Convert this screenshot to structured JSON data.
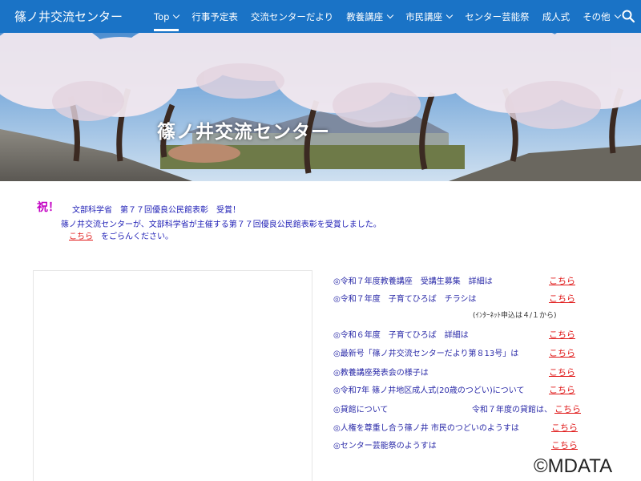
{
  "site": {
    "title": "篠ノ井交流センター"
  },
  "nav": {
    "items": [
      {
        "label": "Top",
        "active": true,
        "dropdown": true
      },
      {
        "label": "行事予定表",
        "active": false,
        "dropdown": false
      },
      {
        "label": "交流センターだより",
        "active": false,
        "dropdown": false
      },
      {
        "label": "教養講座",
        "active": false,
        "dropdown": true
      },
      {
        "label": "市民講座",
        "active": false,
        "dropdown": true
      },
      {
        "label": "センター芸能祭",
        "active": false,
        "dropdown": false
      },
      {
        "label": "成人式",
        "active": false,
        "dropdown": false
      },
      {
        "label": "その他",
        "active": false,
        "dropdown": true
      }
    ],
    "search_icon": "search-icon"
  },
  "hero": {
    "title": "篠ノ井交流センター"
  },
  "notice": {
    "mark": "祝！",
    "headline": "文部科学省　第７７回優良公民館表彰　受賞！",
    "body": "篠ノ井交流センターが、文部科学省が主催する第７７回優良公民館表彰を受賞しました。",
    "link": "こちら",
    "tail": "をごらんください。"
  },
  "links": [
    {
      "text": "◎令和７年度教養講座　受講生募集　詳細は",
      "link": "こちら"
    },
    {
      "text": "◎令和７年度　子育てひろば　チラシは",
      "link": "こちら"
    },
    {
      "text": "◎令和６年度　子育てひろば　詳細は",
      "link": "こちら"
    },
    {
      "text": "◎最新号「篠ノ井交流センターだより第８13号」は",
      "link": "こちら"
    },
    {
      "text": "◎教養講座発表会の様子は",
      "link": "こちら"
    },
    {
      "text": "◎令和7年 篠ノ井地区成人式(20歳のつどい)について",
      "link": "こちら"
    },
    {
      "text": "◎貸館について",
      "extra": "令和７年度の貸館は、",
      "link": "こちら"
    },
    {
      "text": "◎人権を尊重し合う篠ノ井 市民のつどいのようすは",
      "link": "こちら"
    },
    {
      "text": "◎センター芸能祭のようすは",
      "link": "こちら"
    }
  ],
  "note": "(ｲﾝﾀｰﾈｯﾄ申込は４/１から)",
  "copyright": "©MDATA",
  "colors": {
    "nav_bg": "#1a73c6",
    "link_red": "#e01919",
    "text_blue": "#2a2aa8",
    "accent_magenta": "#c300c3"
  }
}
